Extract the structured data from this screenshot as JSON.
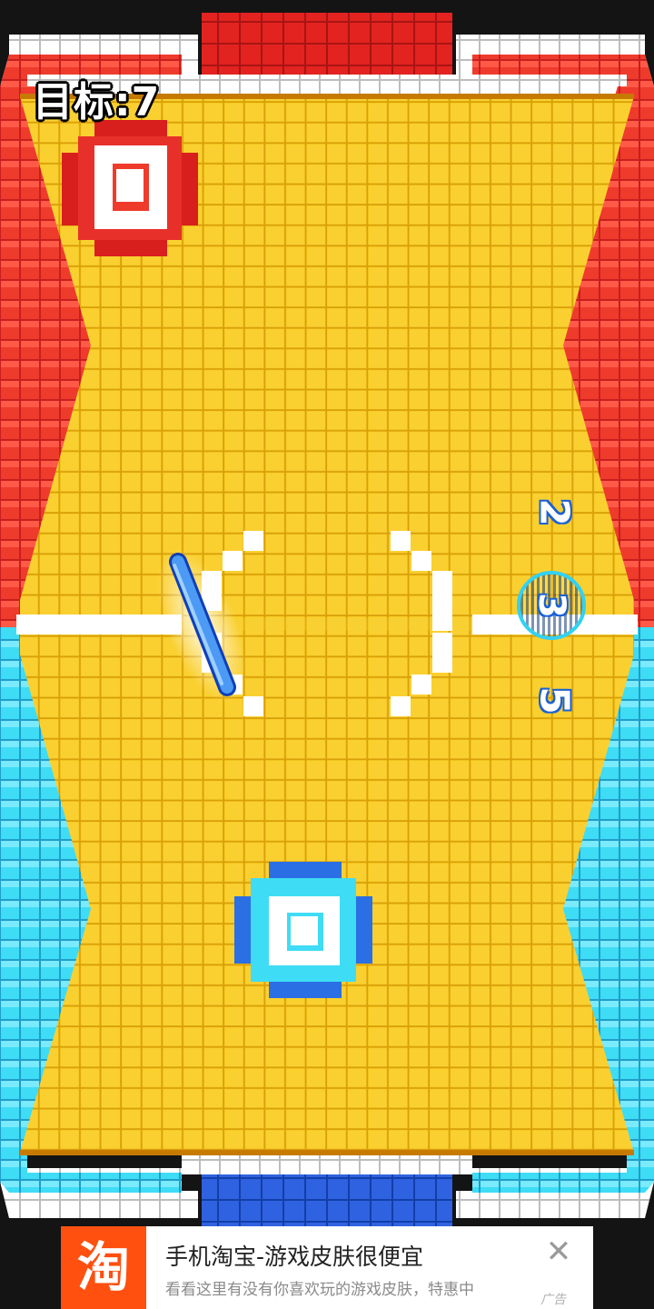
{
  "hud": {
    "target_label": "目标:7"
  },
  "scores": {
    "top": "2",
    "center": "3",
    "bottom": "5"
  },
  "colors": {
    "field": "#f7c613",
    "red_team": "#ef3b2c",
    "blue_team": "#3fdcf5",
    "wall_white": "#ffffff"
  },
  "icons": {
    "paddle": "blue-stick-icon",
    "red_goal": "red-target-icon",
    "blue_goal": "blue-target-icon"
  },
  "ad": {
    "logo_char": "淘",
    "title": "手机淘宝-游戏皮肤很便宜",
    "subtitle": "看看这里有没有你喜欢玩的游戏皮肤，特惠中",
    "close_symbol": "✕",
    "tag": "广告"
  }
}
